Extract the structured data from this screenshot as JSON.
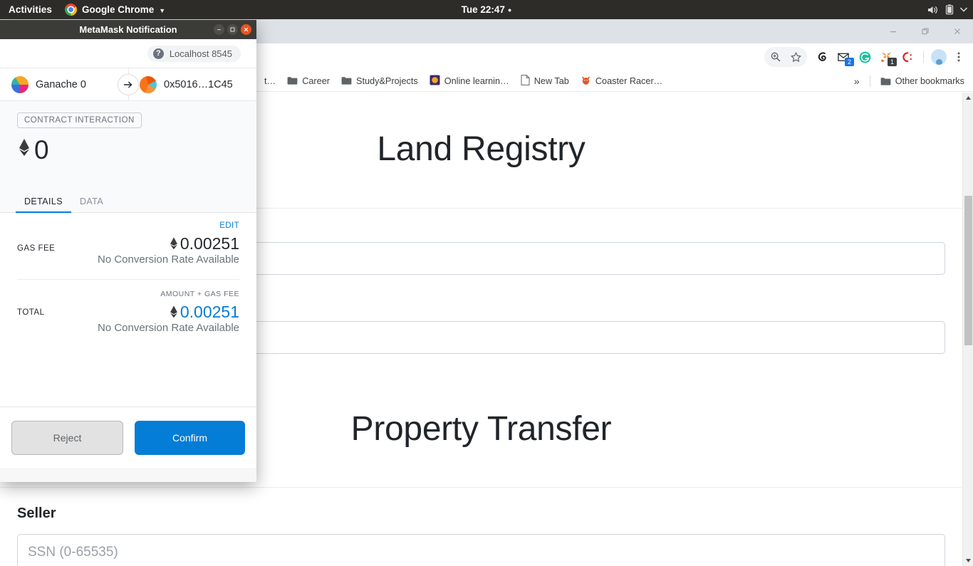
{
  "desktop": {
    "activities_label": "Activities",
    "app_menu_label": "Google Chrome",
    "clock": "Tue 22:47",
    "tray_icons": [
      "volume-icon",
      "battery-icon",
      "system-menu-caret-icon"
    ]
  },
  "browser": {
    "window_controls": [
      "minimize",
      "restore",
      "close"
    ],
    "toolbar_icons": [
      "zoom-icon",
      "bookmark-star-icon",
      "extension-chameleon-icon",
      "extension-mail-icon",
      "extension-grammarly-icon",
      "extension-metamask-icon",
      "extension-colorzilla-icon",
      "profile-avatar-icon",
      "chrome-menu-icon"
    ],
    "badges": {
      "mail": "2",
      "metamask": "1"
    },
    "bookmarks": [
      {
        "label": "t…",
        "icon": "bookmark-truncated-icon"
      },
      {
        "label": "Career",
        "icon": "folder-icon"
      },
      {
        "label": "Study&Projects",
        "icon": "folder-icon"
      },
      {
        "label": "Online learnin…",
        "icon": "site-icon"
      },
      {
        "label": "New Tab",
        "icon": "page-icon"
      },
      {
        "label": "Coaster Racer…",
        "icon": "site-icon"
      }
    ],
    "overflow_label": "»",
    "other_bookmarks_label": "Other bookmarks"
  },
  "page": {
    "title": "Land Registry",
    "section_title": "Property Transfer",
    "seller_label": "Seller",
    "ssn_placeholder": "SSN (0-65535)",
    "field_1_value": "",
    "field_2_value": ""
  },
  "metamask": {
    "window_title": "MetaMask Notification",
    "network_label": "Localhost 8545",
    "from_account": "Ganache 0",
    "to_account": "0x5016…1C45",
    "tx_type": "CONTRACT INTERACTION",
    "amount": "0",
    "tabs": [
      {
        "label": "DETAILS",
        "active": true
      },
      {
        "label": "DATA",
        "active": false
      }
    ],
    "edit_label": "EDIT",
    "gas_fee": {
      "key": "GAS FEE",
      "value": "0.00251",
      "sub": "No Conversion Rate Available"
    },
    "total": {
      "key": "TOTAL",
      "kicker": "AMOUNT + GAS FEE",
      "value": "0.00251",
      "sub": "No Conversion Rate Available"
    },
    "reject_label": "Reject",
    "confirm_label": "Confirm",
    "accent_color": "#037dd6"
  }
}
